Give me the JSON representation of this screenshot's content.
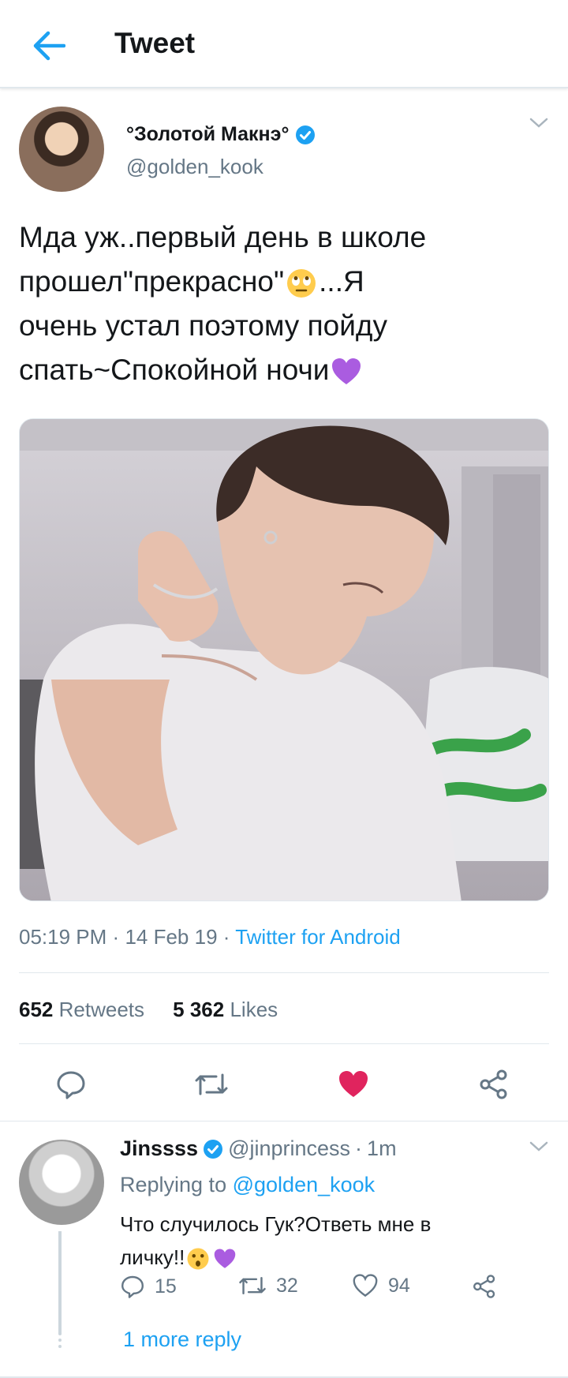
{
  "header": {
    "title": "Tweet",
    "back_icon": "arrow-left-icon",
    "accent": "#1da1f2"
  },
  "tweet": {
    "author_name": "°Золотой Макнэ°",
    "author_handle": "@golden_kook",
    "verified": true,
    "text_line1": "Мда уж..первый день в школе",
    "text_line2a": "прошел\"прекрасно\"",
    "text_line2b": "...Я",
    "text_line3": "очень устал поэтому пойду",
    "text_line4": "спать~Спокойной ночи",
    "emoji_1": "face-with-rolling-eyes",
    "emoji_2": "purple-heart",
    "media": "photo",
    "time": "05:19 PM",
    "date": "14 Feb 19",
    "source": "Twitter for Android",
    "retweets_count": "652",
    "retweets_label": "Retweets",
    "likes_count": "5 362",
    "likes_label": "Likes",
    "liked": true,
    "like_color": "#e0245e"
  },
  "reply": {
    "author_name": "Jinssss",
    "verified": true,
    "author_handle": "@jinprincess",
    "age": "1m",
    "replying_prefix": "Replying to",
    "replying_to": "@golden_kook",
    "text_line1": "Что случилось Гук?Ответь мне в",
    "text_line2": "личку!!",
    "emoji_1": "hushed-face",
    "emoji_2": "purple-heart",
    "reply_count": "15",
    "retweet_count": "32",
    "like_count": "94",
    "more_replies": "1 more reply"
  }
}
